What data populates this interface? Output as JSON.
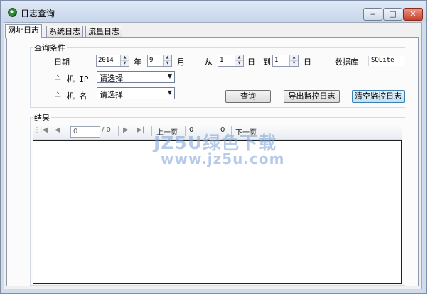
{
  "window": {
    "title": "日志查询",
    "minimize": "‒",
    "maximize": "□",
    "close": "✕"
  },
  "tabs": [
    "网址日志",
    "系统日志",
    "流量日志"
  ],
  "query": {
    "group_label": "查询条件",
    "date_label": "日期",
    "year": "2014",
    "year_unit": "年",
    "month": "9",
    "month_unit": "月",
    "from_label": "从",
    "from_day": "1",
    "day_unit_1": "日",
    "to_label": "到",
    "to_day": "1",
    "day_unit_2": "日",
    "db_label": "数据库",
    "db_value": "SQLite",
    "host_ip_label": "主 机 IP",
    "host_ip_value": "请选择",
    "host_name_label": "主 机 名",
    "host_name_value": "请选择",
    "query_button": "查询",
    "export_button": "导出监控日志",
    "clear_button": "清空监控日志"
  },
  "results": {
    "group_label": "结果",
    "page_value": "0",
    "page_total": "/ 0",
    "prev_page": "上一页",
    "count_1": "0",
    "count_2": "0",
    "next_page": "下一页"
  },
  "watermark": {
    "line1": "JZ5U绿色下载",
    "line2": "www.jz5u.com"
  }
}
